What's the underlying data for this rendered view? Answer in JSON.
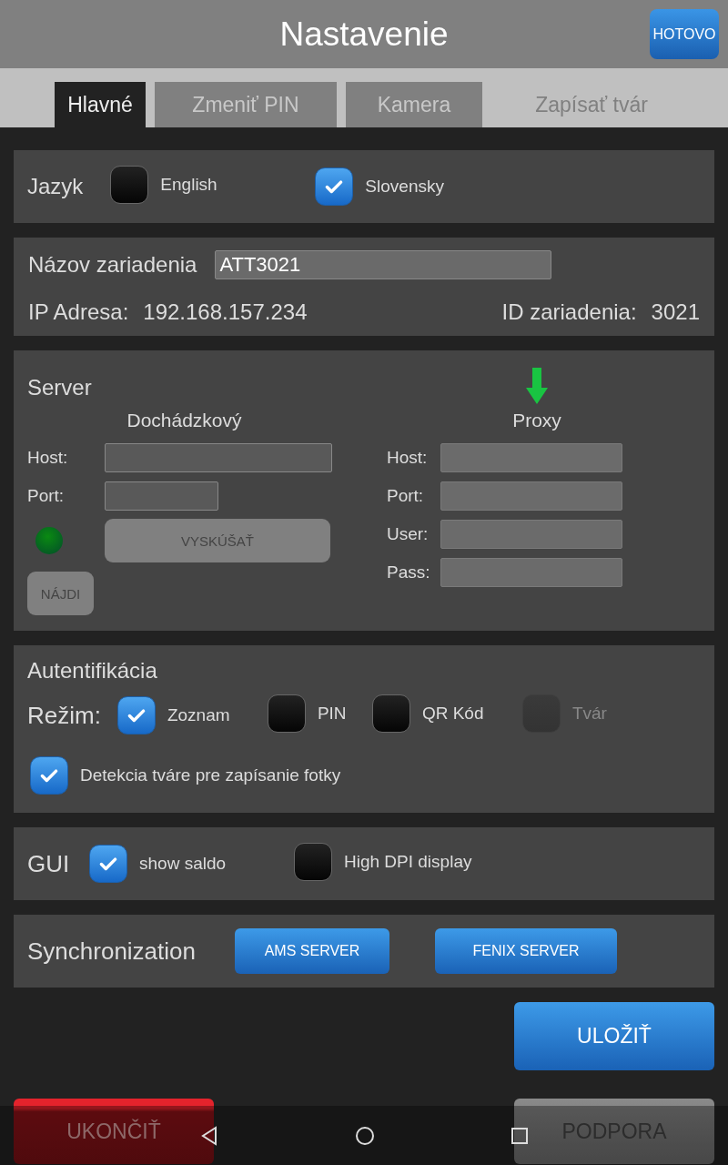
{
  "header": {
    "title": "Nastavenie",
    "done_button": "HOTOVO"
  },
  "tabs": [
    {
      "label": "Hlavné",
      "selected": true,
      "disabled": false
    },
    {
      "label": "Zmeniť PIN",
      "selected": false,
      "disabled": false
    },
    {
      "label": "Kamera",
      "selected": false,
      "disabled": false
    },
    {
      "label": "Zapísať tvár",
      "selected": false,
      "disabled": true
    }
  ],
  "language": {
    "label": "Jazyk",
    "options": [
      {
        "label": "English",
        "checked": false
      },
      {
        "label": "Slovensky",
        "checked": true
      }
    ]
  },
  "device": {
    "name_label": "Názov zariadenia",
    "name_value": "ATT3021",
    "ip_label": "IP Adresa:",
    "ip_value": "192.168.157.234",
    "id_label": "ID zariadenia:",
    "id_value": "3021"
  },
  "server": {
    "title": "Server",
    "attendance": {
      "heading": "Dochádzkový",
      "fields": [
        {
          "label": "Host:"
        },
        {
          "label": "Port:"
        }
      ],
      "connected": true,
      "test_button": "VYSKÚŠAŤ",
      "find_button": "NÁJDI"
    },
    "proxy": {
      "heading": "Proxy",
      "fields": [
        {
          "label": "Host:"
        },
        {
          "label": "Port:"
        },
        {
          "label": "User:"
        },
        {
          "label": "Pass:"
        }
      ]
    }
  },
  "auth": {
    "title": "Autentifikácia",
    "mode_label": "Režim:",
    "modes": [
      {
        "label": "Zoznam",
        "checked": true,
        "disabled": false
      },
      {
        "label": "PIN",
        "checked": false,
        "disabled": false
      },
      {
        "label": "QR Kód",
        "checked": false,
        "disabled": false
      },
      {
        "label": "Tvár",
        "checked": false,
        "disabled": true
      }
    ],
    "face_detection": {
      "label": "Detekcia tváre pre zapísanie fotky",
      "checked": true
    }
  },
  "gui": {
    "label": "GUI",
    "options": [
      {
        "label": "show saldo",
        "checked": true
      },
      {
        "label": "High DPI display",
        "checked": false
      }
    ]
  },
  "sync": {
    "label": "Synchronization",
    "buttons": [
      "AMS SERVER",
      "FENIX SERVER"
    ]
  },
  "actions": {
    "save": "ULOŽIŤ",
    "quit": "UKONČIŤ",
    "support": "PODPORA"
  }
}
